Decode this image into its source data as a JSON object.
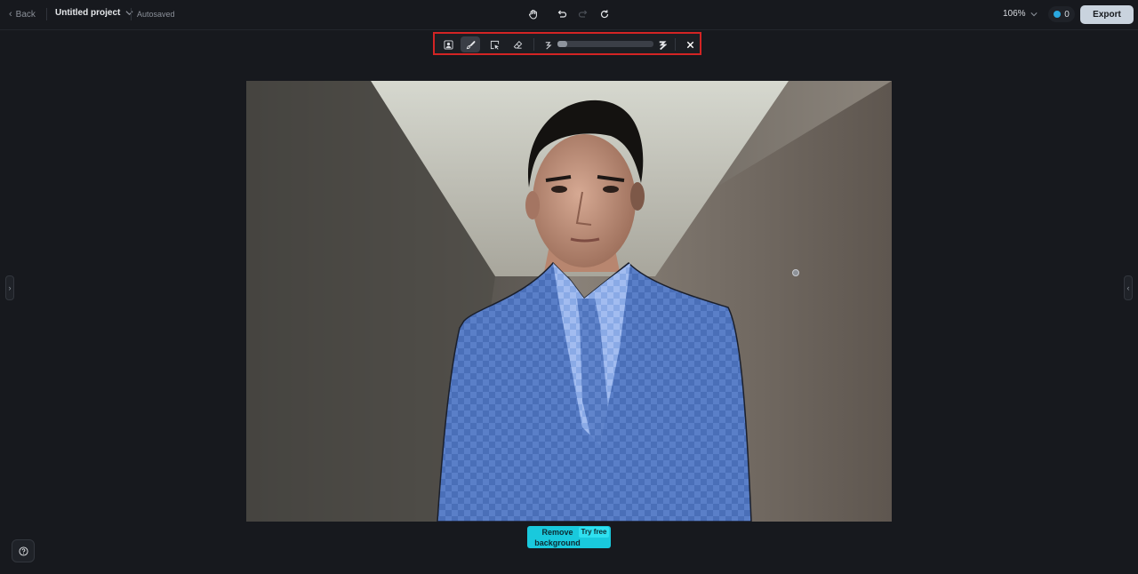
{
  "header": {
    "back_label": "Back",
    "project_title": "Untitled project",
    "save_status": "Autosaved",
    "zoom_level": "106%",
    "credits": "0",
    "export_label": "Export"
  },
  "brush_toolbar": {
    "tools": [
      {
        "name": "auto-select",
        "icon": "person-select-icon"
      },
      {
        "name": "brush",
        "icon": "brush-icon",
        "active": true
      },
      {
        "name": "quick-select",
        "icon": "cursor-select-icon"
      },
      {
        "name": "eraser",
        "icon": "eraser-icon"
      }
    ],
    "brush_size_fraction": 0.1
  },
  "canvas_actions": {
    "remove_background_label": "Remove background",
    "try_free_label": "Try free"
  },
  "colors": {
    "accent": "#19c9dd",
    "highlight_border": "#d32424",
    "mask": "#3c64c8"
  }
}
